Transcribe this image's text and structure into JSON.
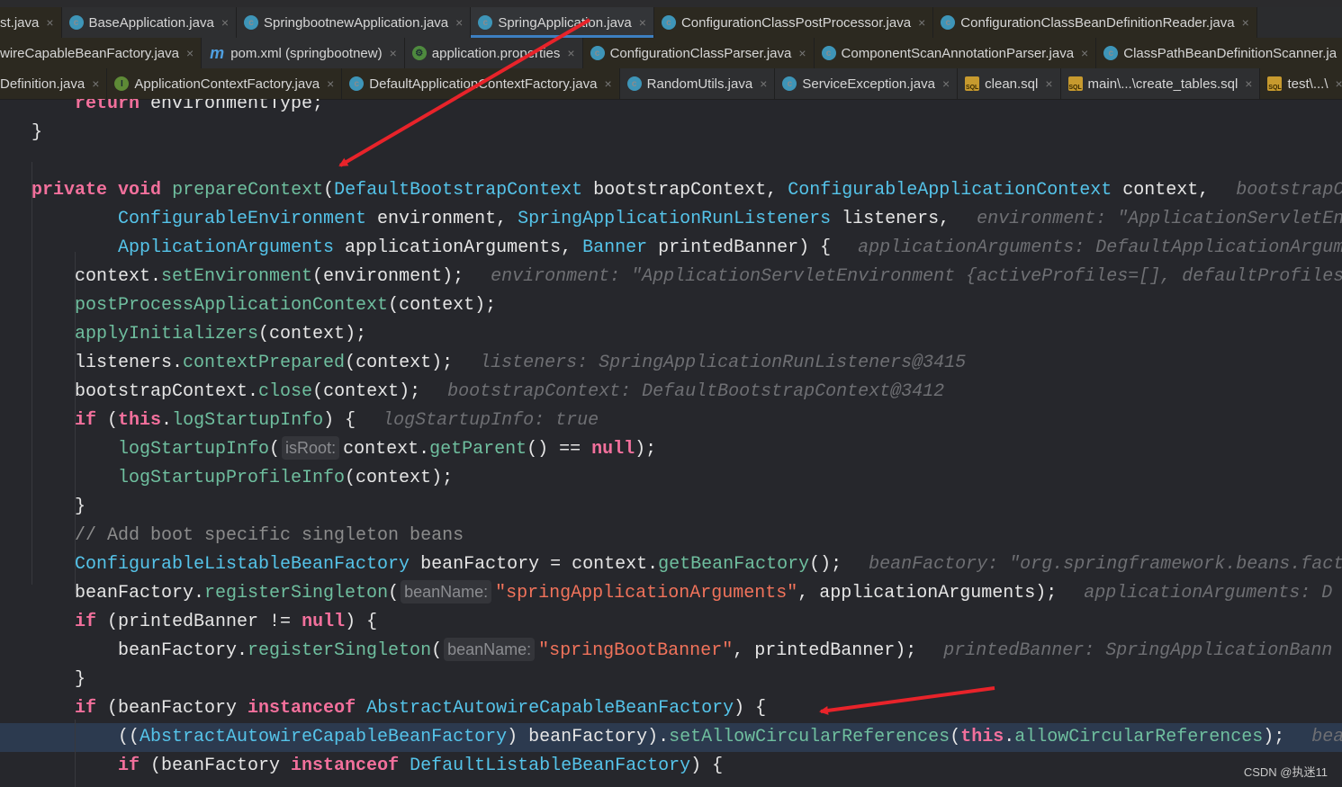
{
  "tabs": {
    "row1": [
      {
        "label": "st.java",
        "icon": "none",
        "style": "alt"
      },
      {
        "label": "BaseApplication.java",
        "icon": "c"
      },
      {
        "label": "SpringbootnewApplication.java",
        "icon": "c"
      },
      {
        "label": "SpringApplication.java",
        "icon": "c",
        "active": true
      },
      {
        "label": "ConfigurationClassPostProcessor.java",
        "icon": "c",
        "style": "alt"
      },
      {
        "label": "ConfigurationClassBeanDefinitionReader.java",
        "icon": "c",
        "style": "alt"
      }
    ],
    "row2": [
      {
        "label": "wireCapableBeanFactory.java",
        "icon": "none",
        "style": "alt"
      },
      {
        "label": "pom.xml (springbootnew)",
        "icon": "m"
      },
      {
        "label": "application.properties",
        "icon": "sp"
      },
      {
        "label": "ConfigurationClassParser.java",
        "icon": "c",
        "style": "alt"
      },
      {
        "label": "ComponentScanAnnotationParser.java",
        "icon": "c",
        "style": "alt"
      },
      {
        "label": "ClassPathBeanDefinitionScanner.ja",
        "icon": "c",
        "style": "alt"
      }
    ],
    "row3": [
      {
        "label": "Definition.java",
        "icon": "none",
        "style": "alt"
      },
      {
        "label": "ApplicationContextFactory.java",
        "icon": "i",
        "style": "alt"
      },
      {
        "label": "DefaultApplicationContextFactory.java",
        "icon": "c",
        "style": "alt"
      },
      {
        "label": "RandomUtils.java",
        "icon": "c"
      },
      {
        "label": "ServiceException.java",
        "icon": "c"
      },
      {
        "label": "clean.sql",
        "icon": "sql"
      },
      {
        "label": "main\\...\\create_tables.sql",
        "icon": "sql"
      },
      {
        "label": "test\\...\\",
        "icon": "sql",
        "style": "alt"
      }
    ],
    "close_glyph": "×",
    "icon_text": {
      "c": "c",
      "i": "I",
      "m": "m",
      "sp": "⚙",
      "sql": "SQL"
    }
  },
  "code": {
    "lines": [
      {
        "indent": 4,
        "tokens": [
          [
            "k",
            "return"
          ],
          [
            "p",
            " environmentType;"
          ]
        ]
      },
      {
        "indent": 0,
        "tokens": [
          [
            "p",
            "}"
          ]
        ]
      },
      {
        "indent": 0,
        "tokens": []
      },
      {
        "indent": 0,
        "tokens": [
          [
            "k",
            "private"
          ],
          [
            "p",
            " "
          ],
          [
            "k",
            "void"
          ],
          [
            "p",
            " "
          ],
          [
            "m",
            "prepareContext"
          ],
          [
            "p",
            "("
          ],
          [
            "t",
            "DefaultBootstrapContext"
          ],
          [
            "p",
            " bootstrapContext, "
          ],
          [
            "t",
            "ConfigurableApplicationContext"
          ],
          [
            "p",
            " context,"
          ],
          [
            "h",
            "bootstrapContext: DefaultBootstrapC"
          ]
        ]
      },
      {
        "indent": 8,
        "tokens": [
          [
            "t",
            "ConfigurableEnvironment"
          ],
          [
            "p",
            " environment, "
          ],
          [
            "t",
            "SpringApplicationRunListeners"
          ],
          [
            "p",
            " listeners,"
          ],
          [
            "h",
            "environment: \"ApplicationServletEn"
          ]
        ]
      },
      {
        "indent": 8,
        "tokens": [
          [
            "t",
            "ApplicationArguments"
          ],
          [
            "p",
            " applicationArguments, "
          ],
          [
            "t",
            "Banner"
          ],
          [
            "p",
            " printedBanner) {"
          ],
          [
            "h",
            "applicationArguments: DefaultApplicationArgum"
          ]
        ]
      },
      {
        "indent": 4,
        "tokens": [
          [
            "p",
            "context."
          ],
          [
            "m",
            "setEnvironment"
          ],
          [
            "p",
            "(environment);"
          ],
          [
            "h",
            "environment: \"ApplicationServletEnvironment {activeProfiles=[], defaultProfiles"
          ]
        ]
      },
      {
        "indent": 4,
        "tokens": [
          [
            "m",
            "postProcessApplicationContext"
          ],
          [
            "p",
            "(context);"
          ]
        ]
      },
      {
        "indent": 4,
        "tokens": [
          [
            "m",
            "applyInitializers"
          ],
          [
            "p",
            "(context);"
          ]
        ]
      },
      {
        "indent": 4,
        "tokens": [
          [
            "p",
            "listeners."
          ],
          [
            "m",
            "contextPrepared"
          ],
          [
            "p",
            "(context);"
          ],
          [
            "h",
            "listeners: SpringApplicationRunListeners@3415"
          ]
        ]
      },
      {
        "indent": 4,
        "tokens": [
          [
            "p",
            "bootstrapContext."
          ],
          [
            "m",
            "close"
          ],
          [
            "p",
            "(context);"
          ],
          [
            "h",
            "bootstrapContext: DefaultBootstrapContext@3412"
          ]
        ]
      },
      {
        "indent": 4,
        "tokens": [
          [
            "k",
            "if"
          ],
          [
            "p",
            " ("
          ],
          [
            "k",
            "this"
          ],
          [
            "p",
            "."
          ],
          [
            "m",
            "logStartupInfo"
          ],
          [
            "p",
            ") {"
          ],
          [
            "h",
            "logStartupInfo: true"
          ]
        ]
      },
      {
        "indent": 8,
        "tokens": [
          [
            "m",
            "logStartupInfo"
          ],
          [
            "p",
            "("
          ],
          [
            "pb",
            "isRoot:"
          ],
          [
            "p",
            "context."
          ],
          [
            "m",
            "getParent"
          ],
          [
            "p",
            "() == "
          ],
          [
            "k",
            "null"
          ],
          [
            "p",
            ");"
          ]
        ]
      },
      {
        "indent": 8,
        "tokens": [
          [
            "m",
            "logStartupProfileInfo"
          ],
          [
            "p",
            "(context);"
          ]
        ]
      },
      {
        "indent": 4,
        "tokens": [
          [
            "p",
            "}"
          ]
        ]
      },
      {
        "indent": 4,
        "tokens": [
          [
            "c",
            "// Add boot specific singleton beans"
          ]
        ]
      },
      {
        "indent": 4,
        "tokens": [
          [
            "t",
            "ConfigurableListableBeanFactory"
          ],
          [
            "p",
            " beanFactory = context."
          ],
          [
            "m",
            "getBeanFactory"
          ],
          [
            "p",
            "();"
          ],
          [
            "h",
            "beanFactory: \"org.springframework.beans.fact"
          ]
        ]
      },
      {
        "indent": 4,
        "tokens": [
          [
            "p",
            "beanFactory."
          ],
          [
            "m",
            "registerSingleton"
          ],
          [
            "p",
            "("
          ],
          [
            "pb",
            "beanName:"
          ],
          [
            "s",
            "\"springApplicationArguments\""
          ],
          [
            "p",
            ", applicationArguments);"
          ],
          [
            "h",
            "applicationArguments: D"
          ]
        ]
      },
      {
        "indent": 4,
        "tokens": [
          [
            "k",
            "if"
          ],
          [
            "p",
            " (printedBanner != "
          ],
          [
            "k",
            "null"
          ],
          [
            "p",
            ") {"
          ]
        ]
      },
      {
        "indent": 8,
        "tokens": [
          [
            "p",
            "beanFactory."
          ],
          [
            "m",
            "registerSingleton"
          ],
          [
            "p",
            "("
          ],
          [
            "pb",
            "beanName:"
          ],
          [
            "s",
            "\"springBootBanner\""
          ],
          [
            "p",
            ", printedBanner);"
          ],
          [
            "h",
            "printedBanner: SpringApplicationBann"
          ]
        ]
      },
      {
        "indent": 4,
        "tokens": [
          [
            "p",
            "}"
          ]
        ]
      },
      {
        "indent": 4,
        "tokens": [
          [
            "k",
            "if"
          ],
          [
            "p",
            " (beanFactory "
          ],
          [
            "k",
            "instanceof"
          ],
          [
            "p",
            " "
          ],
          [
            "t",
            "AbstractAutowireCapableBeanFactory"
          ],
          [
            "p",
            ") {"
          ]
        ]
      },
      {
        "indent": 8,
        "highlight": true,
        "tokens": [
          [
            "p",
            "(("
          ],
          [
            "t",
            "AbstractAutowireCapableBeanFactory"
          ],
          [
            "p",
            ") beanFactory)."
          ],
          [
            "m",
            "setAllowCircularReferences"
          ],
          [
            "p",
            "("
          ],
          [
            "k",
            "this"
          ],
          [
            "p",
            "."
          ],
          [
            "m",
            "allowCircularReferences"
          ],
          [
            "p",
            ");"
          ],
          [
            "h",
            "bea"
          ]
        ]
      },
      {
        "indent": 8,
        "tokens": [
          [
            "k",
            "if"
          ],
          [
            "p",
            " (beanFactory "
          ],
          [
            "k",
            "instanceof"
          ],
          [
            "p",
            " "
          ],
          [
            "t",
            "DefaultListableBeanFactory"
          ],
          [
            "p",
            ") {"
          ]
        ]
      }
    ]
  },
  "annotations": {
    "arrow_color": "#e8232a"
  },
  "watermark": "CSDN @执迷11"
}
